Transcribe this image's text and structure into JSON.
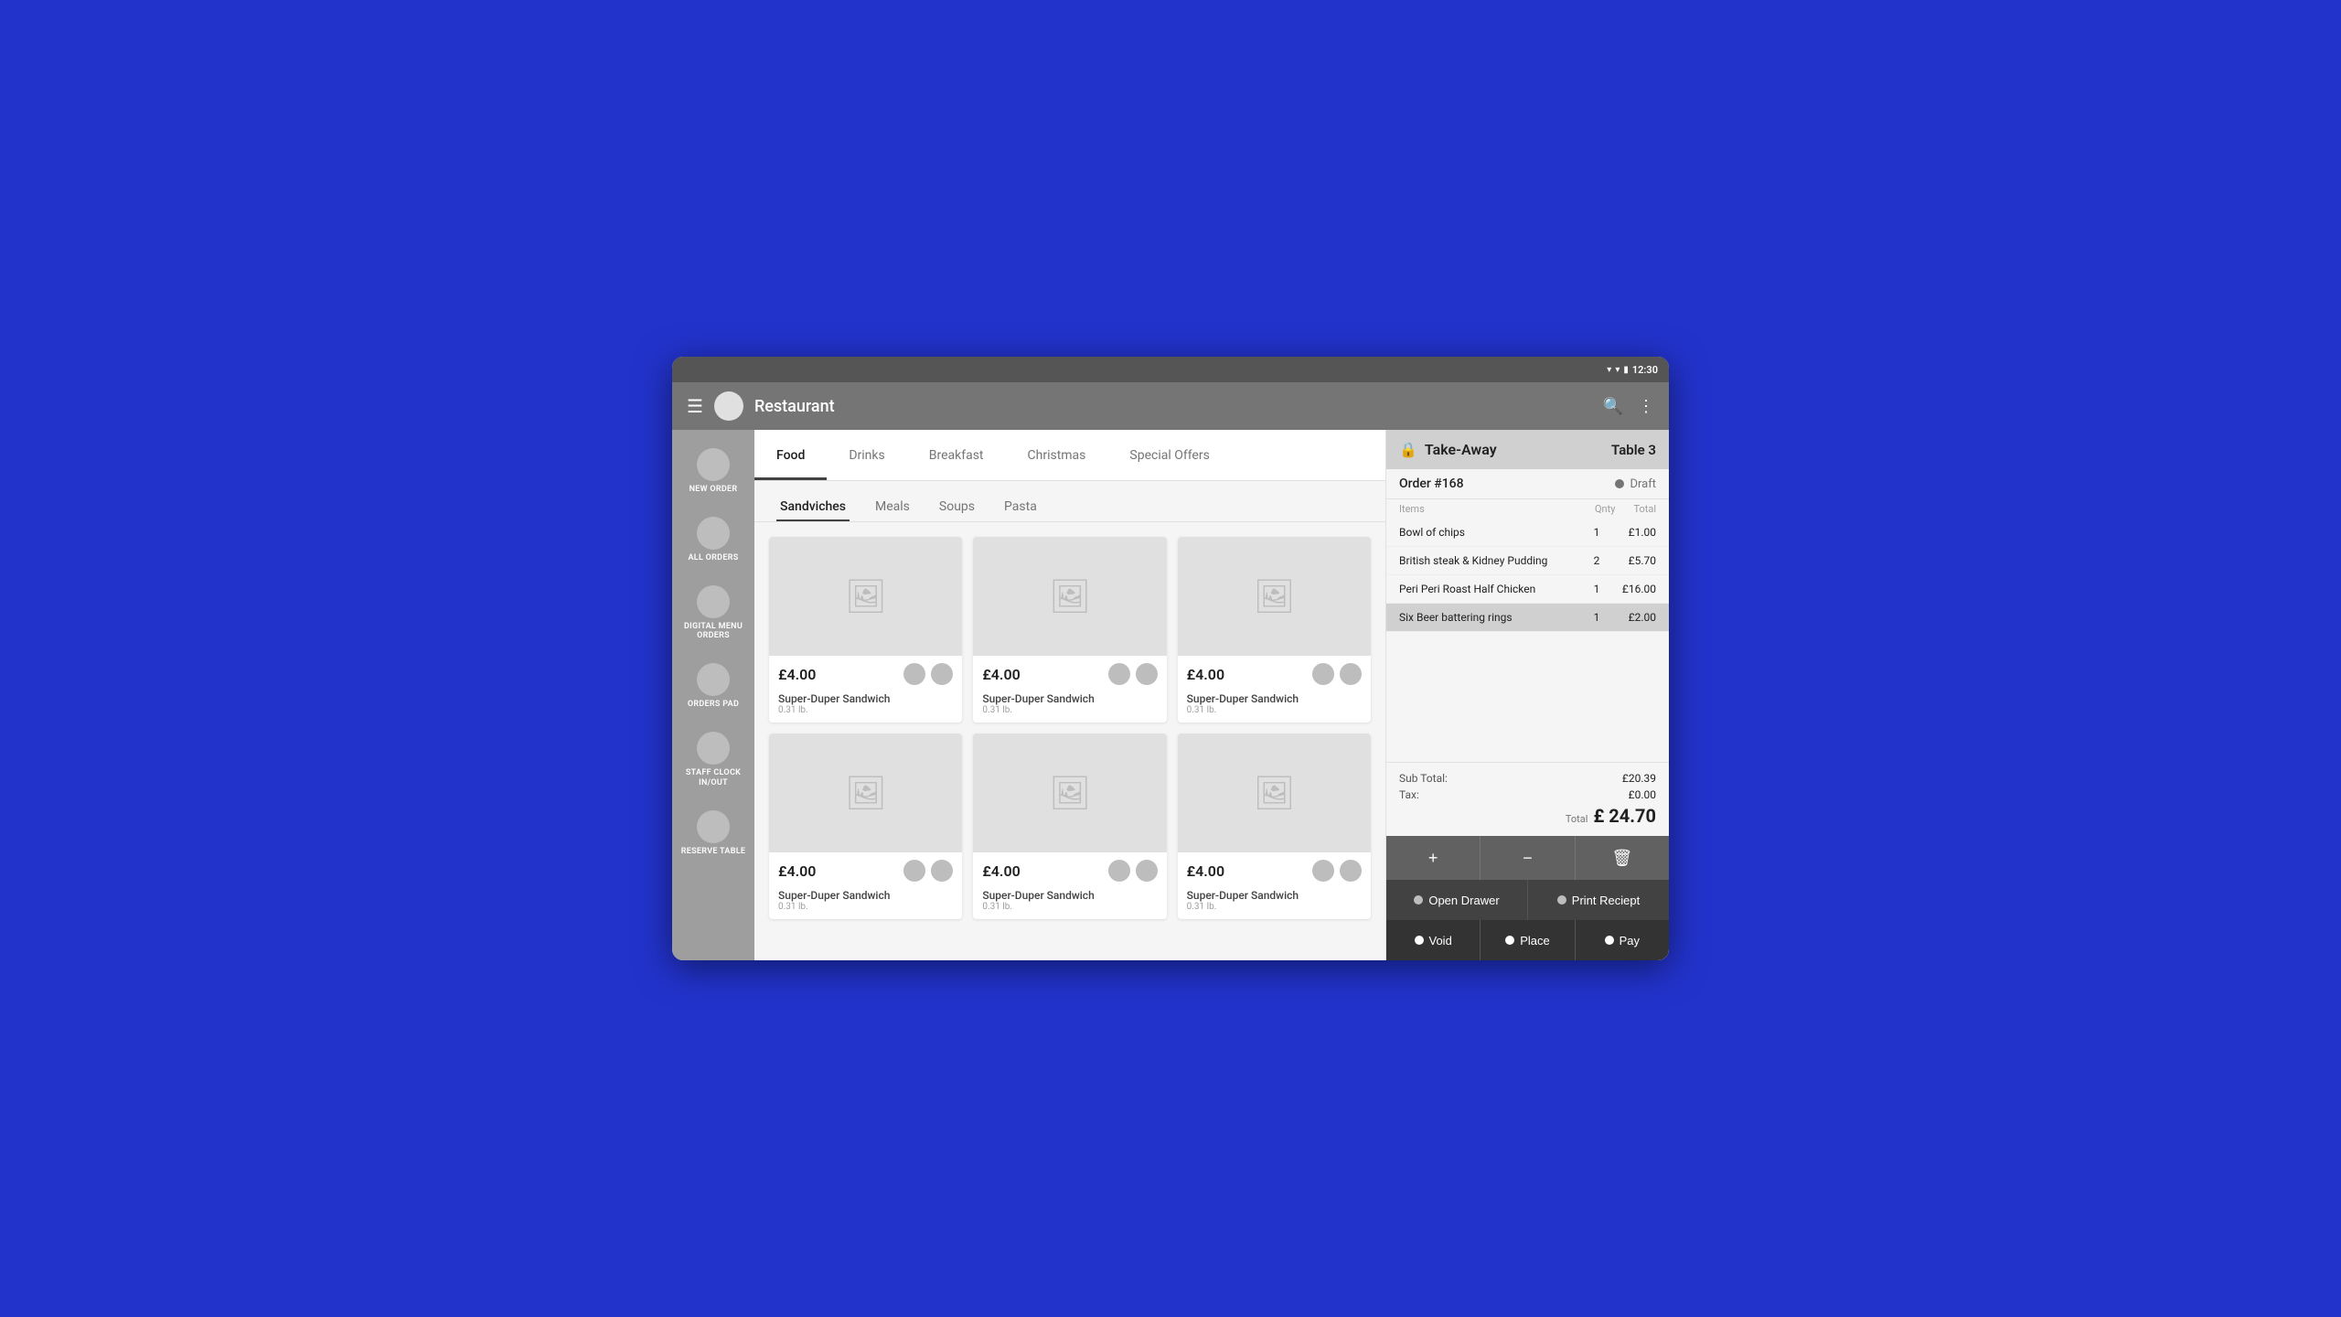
{
  "statusBar": {
    "time": "12:30",
    "wifiIcon": "▾",
    "signalIcon": "▾",
    "batteryIcon": "▮"
  },
  "appBar": {
    "title": "Restaurant",
    "menuIcon": "☰",
    "searchIcon": "🔍",
    "moreIcon": "⋮"
  },
  "sidebar": {
    "items": [
      {
        "id": "new-order",
        "label": "NEW ORDER"
      },
      {
        "id": "all-orders",
        "label": "ALL ORDERS"
      },
      {
        "id": "digital-menu",
        "label": "DIGITAL MENU ORDERS"
      },
      {
        "id": "orders-pad",
        "label": "ORDERS PAD"
      },
      {
        "id": "staff-clock",
        "label": "STAFF CLOCK IN/OUT"
      },
      {
        "id": "reserve-table",
        "label": "RESERVE TABLE"
      }
    ]
  },
  "categoryTabs": {
    "tabs": [
      {
        "id": "food",
        "label": "Food",
        "active": true
      },
      {
        "id": "drinks",
        "label": "Drinks",
        "active": false
      },
      {
        "id": "breakfast",
        "label": "Breakfast",
        "active": false
      },
      {
        "id": "christmas",
        "label": "Christmas",
        "active": false
      },
      {
        "id": "special-offers",
        "label": "Special Offers",
        "active": false
      }
    ]
  },
  "subTabs": {
    "tabs": [
      {
        "id": "sandwiches",
        "label": "Sandviches",
        "active": true
      },
      {
        "id": "meals",
        "label": "Meals",
        "active": false
      },
      {
        "id": "soups",
        "label": "Soups",
        "active": false
      },
      {
        "id": "pasta",
        "label": "Pasta",
        "active": false
      }
    ]
  },
  "products": [
    {
      "id": "p1",
      "price": "£4.00",
      "name": "Super-Duper Sandwich",
      "weight": "0.31 lb."
    },
    {
      "id": "p2",
      "price": "£4.00",
      "name": "Super-Duper Sandwich",
      "weight": "0.31 lb."
    },
    {
      "id": "p3",
      "price": "£4.00",
      "name": "Super-Duper Sandwich",
      "weight": "0.31 lb."
    },
    {
      "id": "p4",
      "price": "£4.00",
      "name": "Super-Duper Sandwich",
      "weight": "0.31 lb."
    },
    {
      "id": "p5",
      "price": "£4.00",
      "name": "Super-Duper Sandwich",
      "weight": "0.31 lb."
    },
    {
      "id": "p6",
      "price": "£4.00",
      "name": "Super-Duper Sandwich",
      "weight": "0.31 lb."
    }
  ],
  "orderPanel": {
    "typeLabel": "Take-Away",
    "tableLabel": "Table 3",
    "orderNumber": "Order #168",
    "statusLabel": "Draft",
    "colItems": "Items",
    "colQnty": "Qnty",
    "colTotal": "Total",
    "items": [
      {
        "id": "oi1",
        "name": "Bowl of chips",
        "qty": "1",
        "total": "£1.00",
        "selected": false
      },
      {
        "id": "oi2",
        "name": "British steak & Kidney Pudding",
        "qty": "2",
        "total": "£5.70",
        "selected": false
      },
      {
        "id": "oi3",
        "name": "Peri Peri Roast Half Chicken",
        "qty": "1",
        "total": "£16.00",
        "selected": false
      },
      {
        "id": "oi4",
        "name": "Six Beer battering rings",
        "qty": "1",
        "total": "£2.00",
        "selected": true
      }
    ],
    "subTotalLabel": "Sub Total:",
    "subTotalValue": "£20.39",
    "taxLabel": "Tax:",
    "taxValue": "£0.00",
    "grandTotalLabel": "Total",
    "grandTotalValue": "£ 24.70",
    "addIcon": "+",
    "subtractIcon": "−",
    "deleteIcon": "🗑",
    "openDrawerLabel": "Open Drawer",
    "printReceiptLabel": "Print Reciept",
    "voidLabel": "Void",
    "placeLabel": "Place",
    "payLabel": "Pay"
  }
}
